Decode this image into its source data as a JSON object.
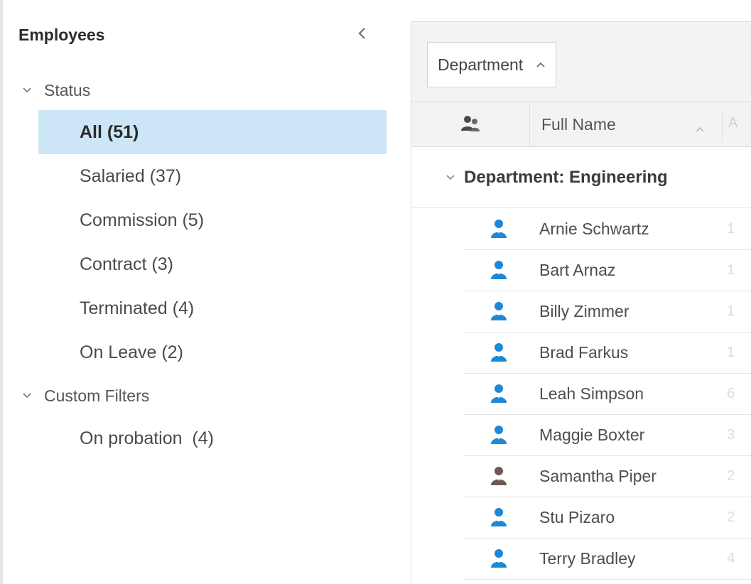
{
  "nav": {
    "title": "Employees",
    "status_group": {
      "label": "Status",
      "items": [
        {
          "label": "All (51)",
          "selected": true
        },
        {
          "label": "Salaried (37)",
          "selected": false
        },
        {
          "label": "Commission (5)",
          "selected": false
        },
        {
          "label": "Contract (3)",
          "selected": false
        },
        {
          "label": "Terminated (4)",
          "selected": false
        },
        {
          "label": "On Leave (2)",
          "selected": false
        }
      ]
    },
    "custom_group": {
      "label": "Custom Filters",
      "items": [
        {
          "label": "On probation  (4)"
        }
      ]
    },
    "collapse_icon": "chevron-left-icon"
  },
  "grid": {
    "group_chip": {
      "label": "Department",
      "icon": "chevron-up-icon"
    },
    "columns": {
      "icon_column": "users-icon",
      "name": "Full Name",
      "sort_icon": "chevron-up-icon"
    },
    "group_row": {
      "label": "Department: Engineering",
      "icon": "chevron-down-icon"
    },
    "rows": [
      {
        "name": "Arnie Schwartz",
        "extra": "1",
        "icon": "person-icon",
        "icon_color": "#1e88d8"
      },
      {
        "name": "Bart Arnaz",
        "extra": "1",
        "icon": "person-icon",
        "icon_color": "#1e88d8"
      },
      {
        "name": "Billy Zimmer",
        "extra": "1",
        "icon": "person-icon",
        "icon_color": "#1e88d8"
      },
      {
        "name": "Brad Farkus",
        "extra": "1",
        "icon": "person-icon",
        "icon_color": "#1e88d8"
      },
      {
        "name": "Leah Simpson",
        "extra": "6",
        "icon": "person-icon",
        "icon_color": "#1e88d8"
      },
      {
        "name": "Maggie Boxter",
        "extra": "3",
        "icon": "person-icon",
        "icon_color": "#1e88d8"
      },
      {
        "name": "Samantha Piper",
        "extra": "2",
        "icon": "person-icon",
        "icon_color": "#6b5a55"
      },
      {
        "name": "Stu Pizaro",
        "extra": "2",
        "icon": "person-icon",
        "icon_color": "#1e88d8"
      },
      {
        "name": "Terry Bradley",
        "extra": "4",
        "icon": "person-icon",
        "icon_color": "#1e88d8"
      }
    ]
  },
  "colors": {
    "selection": "#cde6f7",
    "panel_bg": "#f3f3f3",
    "accent_blue": "#1e88d8"
  }
}
